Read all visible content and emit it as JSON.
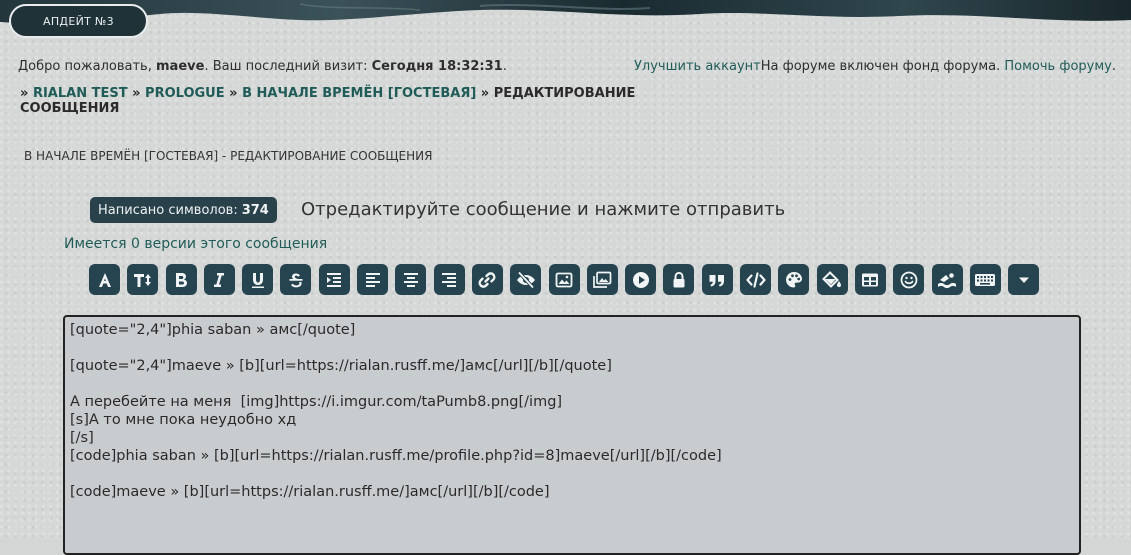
{
  "header": {
    "update_button": "АПДЕЙТ №3"
  },
  "welcome": {
    "prefix": "Добро пожаловать, ",
    "username": "maeve",
    "middle": ". Ваш последний визит: ",
    "last_visit": "Сегодня 18:32:31",
    "suffix": "."
  },
  "right_links": {
    "upgrade": "Улучшить аккаунт",
    "fund_text": "На форуме включен фонд форума. ",
    "help": "Помочь форуму",
    "end": "."
  },
  "breadcrumbs": {
    "sep": "» ",
    "items": [
      "RIALAN TEST",
      "PROLOGUE",
      "В НАЧАЛЕ ВРЕМЁН [ГОСТЕВАЯ]"
    ],
    "current": "РЕДАКТИРОВАНИЕ СООБЩЕНИЯ"
  },
  "page_subtitle": "В НАЧАЛЕ ВРЕМЁН [ГОСТЕВАЯ] - РЕДАКТИРОВАНИЕ СООБЩЕНИЯ",
  "char_counter": {
    "label": "Написано символов:",
    "value": "374"
  },
  "edit_hint": "Отредактируйте сообщение и нажмите отправить",
  "versions_text": "Имеется 0 версии этого сообщения",
  "toolbar_icons": [
    "font-icon",
    "text-size-icon",
    "bold-icon",
    "italic-icon",
    "underline-icon",
    "strikethrough-icon",
    "indent-icon",
    "align-left-icon",
    "align-center-icon",
    "align-right-icon",
    "link-icon",
    "hide-icon",
    "image-icon",
    "gallery-icon",
    "video-icon",
    "lock-icon",
    "quote-icon",
    "code-icon",
    "palette-icon",
    "fill-color-icon",
    "table-icon",
    "smiley-icon",
    "swim-icon",
    "keyboard-icon",
    "more-dropdown-icon"
  ],
  "editor": {
    "lines": [
      "[quote=\"2,4\"]phia saban » амс[/quote]",
      "",
      "[quote=\"2,4\"]maeve » [b][url=https://rialan.rusff.me/]амс[/url][/b][/quote]",
      "",
      "А перебейте на меня  [img]https://i.imgur.com/taPumb8.png[/img]",
      "[s]А то мне пока неудобно хд",
      "[/s]",
      "[code]phia saban » [b][url=https://rialan.rusff.me/profile.php?id=8]maeve[/url][/b][/code]",
      "",
      "[code]maeve » [b][url=https://rialan.rusff.me/]амс[/url][/b][/code]"
    ]
  },
  "colors": {
    "accent": "#26444f",
    "link": "#1f5b57",
    "header_dark": "#1f3238"
  }
}
